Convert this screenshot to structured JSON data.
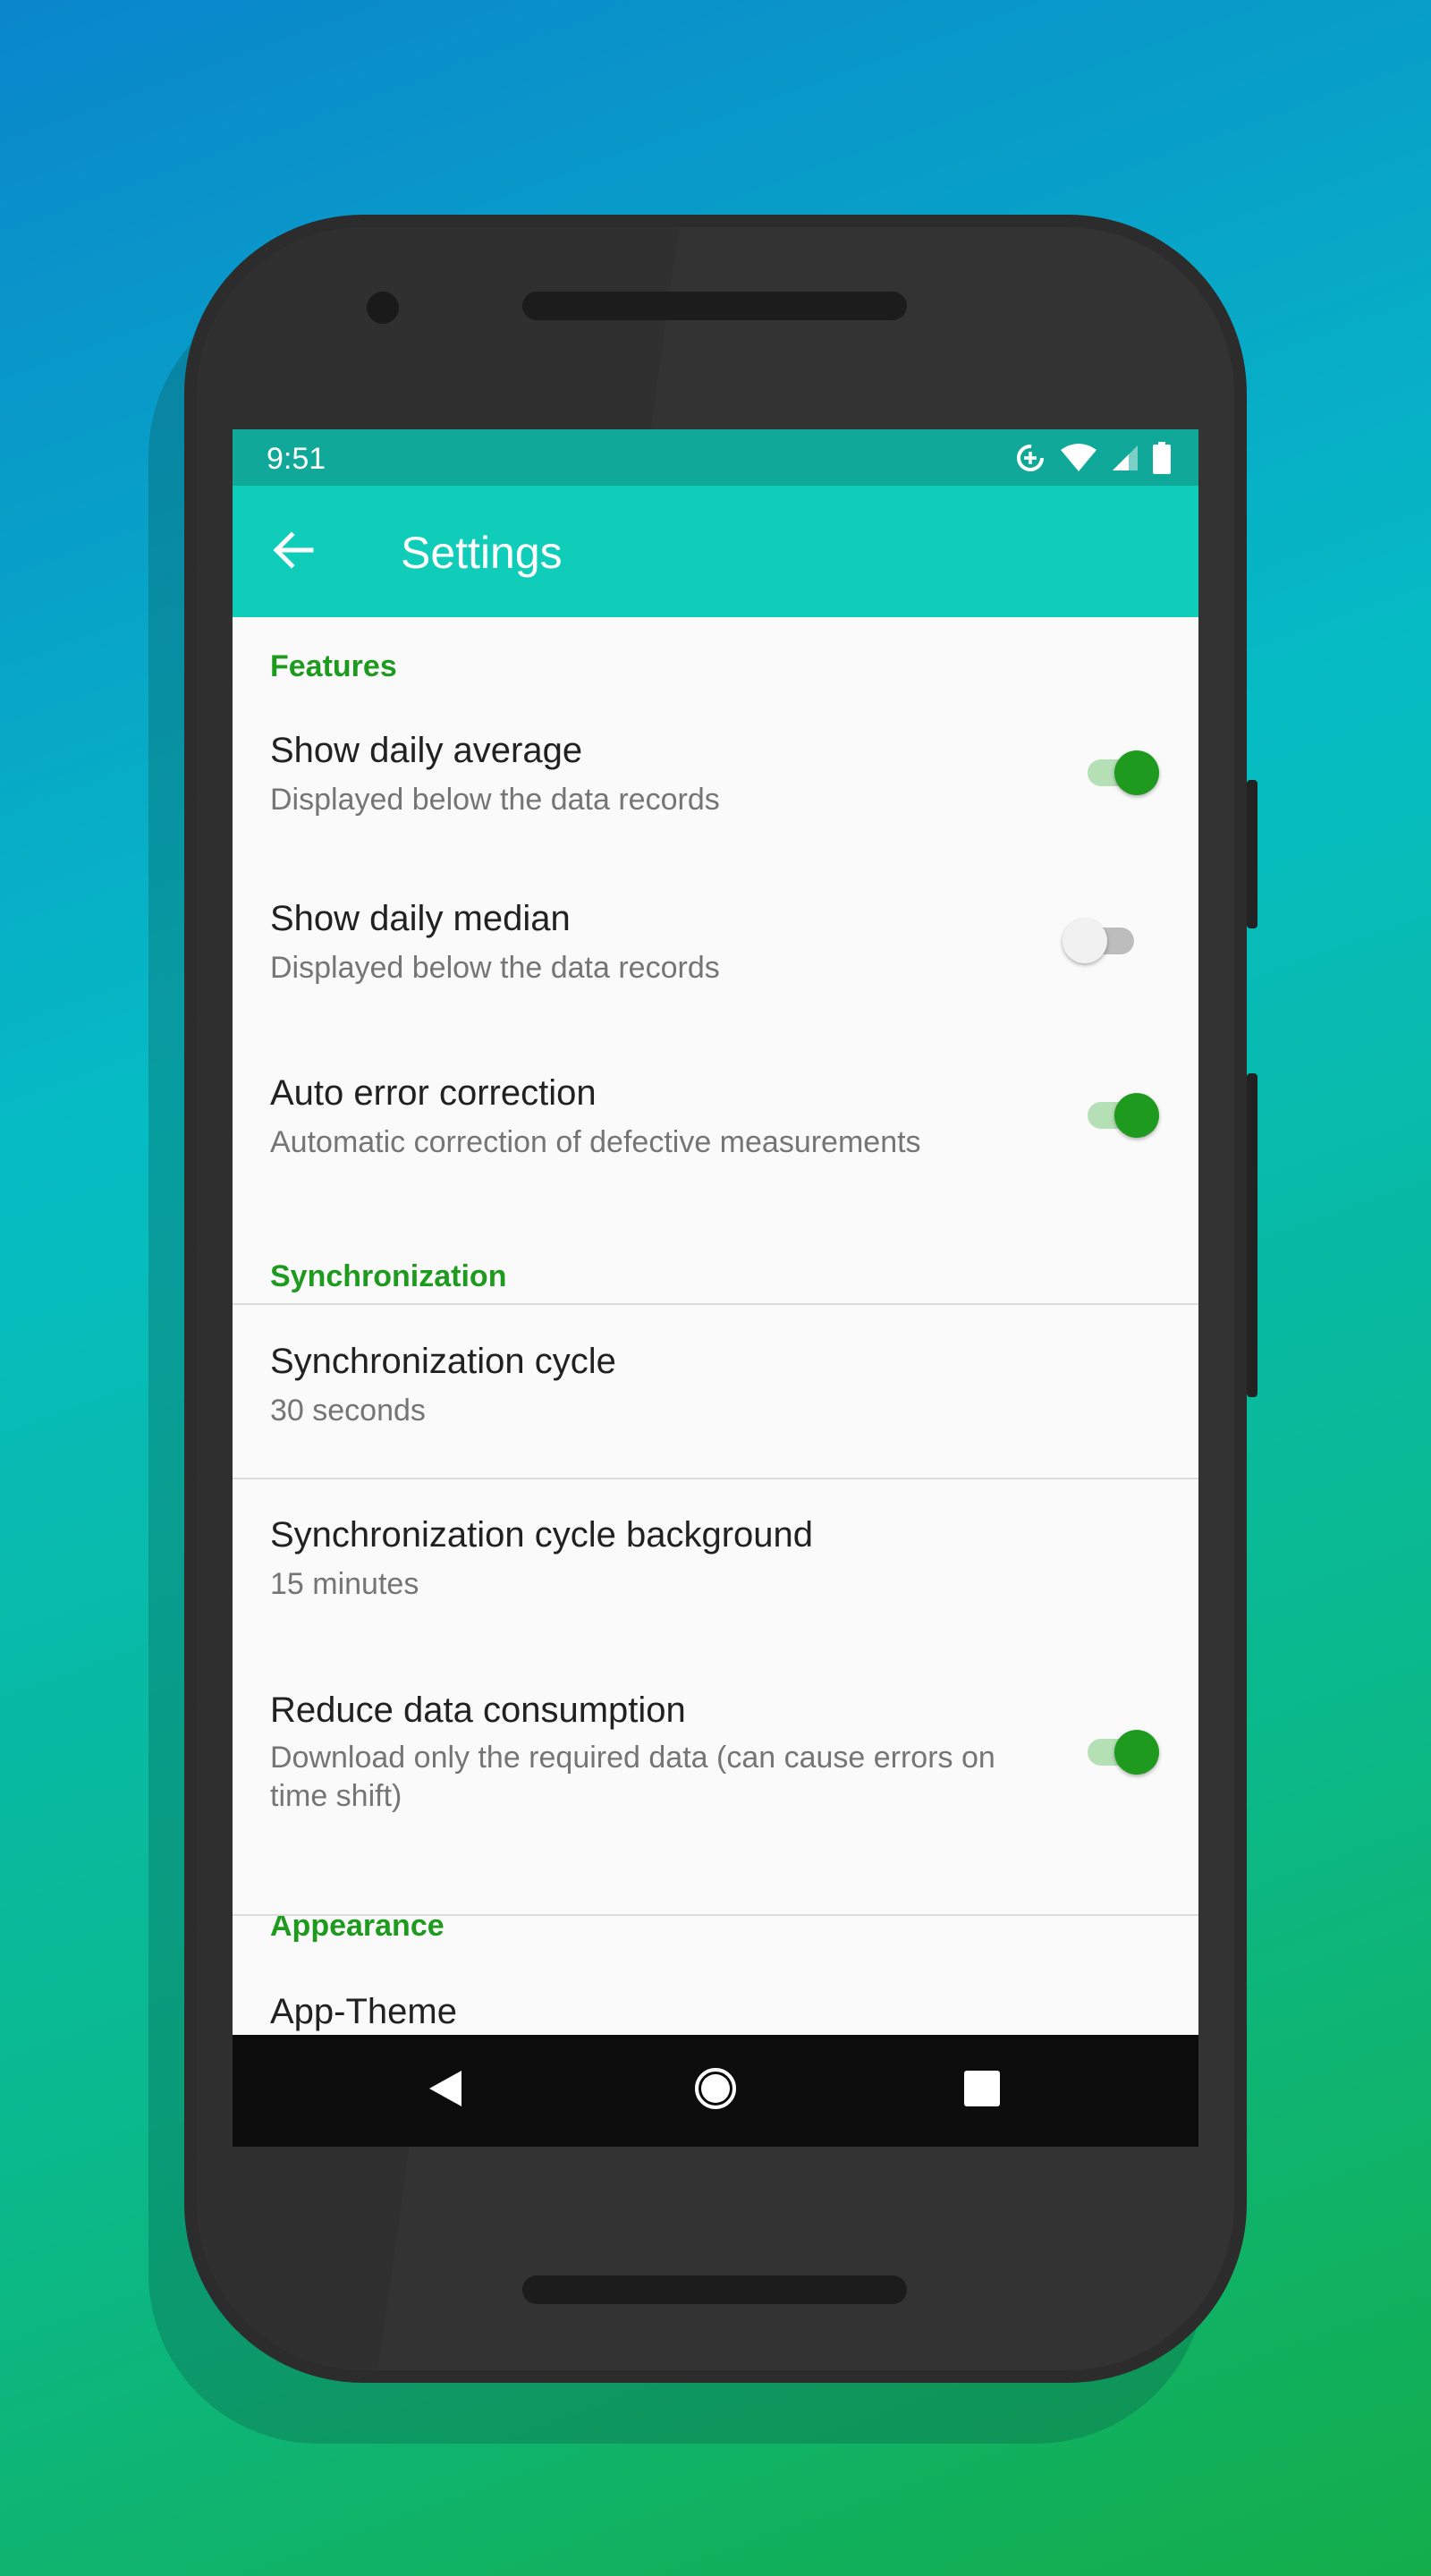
{
  "status_bar": {
    "time": "9:51",
    "icons": [
      "data-saver-icon",
      "wifi-icon",
      "signal-icon",
      "battery-icon"
    ]
  },
  "app_bar": {
    "title": "Settings",
    "back_icon": "arrow-back-icon"
  },
  "colors": {
    "status_bar": "#10a898",
    "app_bar": "#10cdb9",
    "accent": "#1e9a1e"
  },
  "sections": {
    "features": {
      "header": "Features",
      "items": [
        {
          "title": "Show daily average",
          "summary": "Displayed below the data records",
          "checked": true
        },
        {
          "title": "Show daily median",
          "summary": "Displayed below the data records",
          "checked": false
        },
        {
          "title": "Auto error correction",
          "summary": "Automatic correction of defective measurements",
          "checked": true
        }
      ]
    },
    "synchronization": {
      "header": "Synchronization",
      "items": [
        {
          "title": "Synchronization cycle",
          "summary": "30 seconds"
        },
        {
          "title": "Synchronization cycle background",
          "summary": "15 minutes"
        },
        {
          "title": "Reduce data consumption",
          "summary": "Download only the required data (can cause errors on time shift)",
          "checked": true
        }
      ]
    },
    "appearance": {
      "header": "Appearance",
      "items": [
        {
          "title": "App-Theme"
        }
      ]
    }
  },
  "nav_bar": {
    "icons": [
      "back-triangle-icon",
      "home-circle-icon",
      "recents-square-icon"
    ]
  }
}
